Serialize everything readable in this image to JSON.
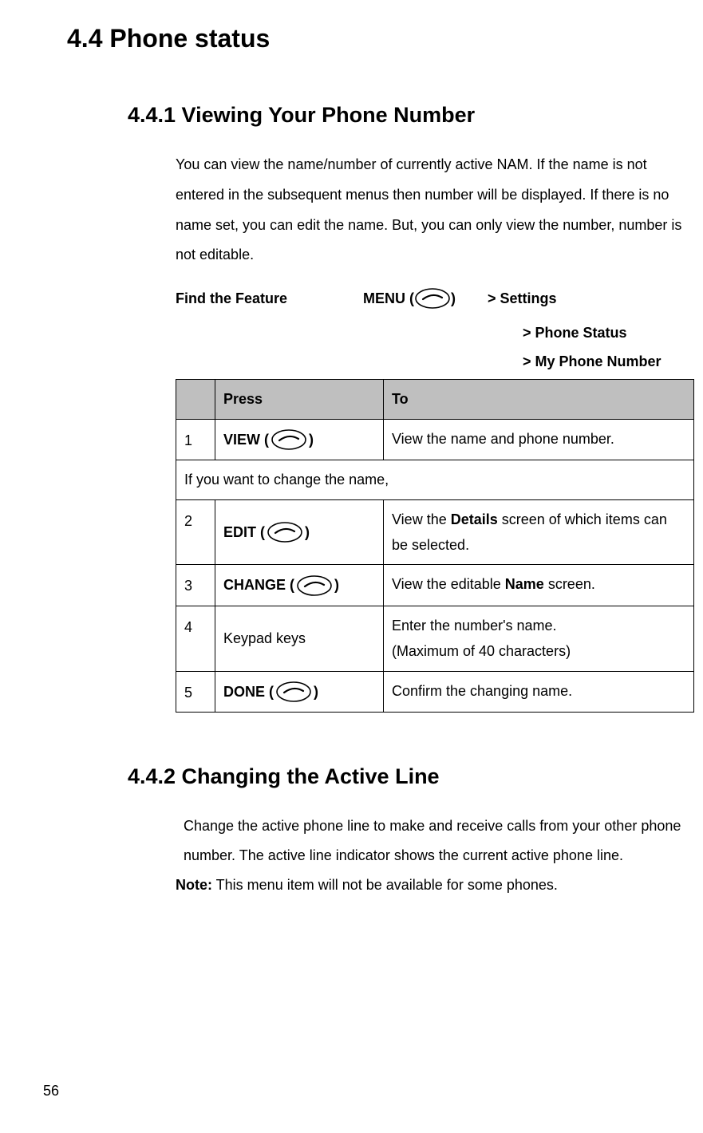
{
  "page_number": "56",
  "h1": "4.4  Phone status",
  "section1": {
    "heading": "4.4.1    Viewing Your Phone Number",
    "para": "You can view the name/number of currently active NAM. If the name is not entered in the subsequent menus then number will be displayed. If there is no name set, you can edit the name. But, you can only view the number, number is not editable.",
    "find_label": "Find the Feature",
    "menu_prefix": "MENU (",
    "menu_suffix": ")",
    "crumb1": "> Settings",
    "crumb2": "> Phone Status",
    "crumb3": "> My Phone Number"
  },
  "table": {
    "headers": {
      "press": "Press",
      "to": "To"
    },
    "rows": [
      {
        "num": "1",
        "press_prefix": "VIEW (",
        "press_suffix": ")",
        "has_icon": true,
        "to_html": "View the name and phone number."
      }
    ],
    "span_row": "If you want to change the name,",
    "rows2": [
      {
        "num": "2",
        "press_prefix": "EDIT (",
        "press_suffix": ")",
        "has_icon": true,
        "to_pre": "View the ",
        "to_bold": "Details",
        "to_post": " screen of which items can be selected."
      },
      {
        "num": "3",
        "press_prefix": "CHANGE (",
        "press_suffix": ")",
        "has_icon": true,
        "to_pre": "View the editable ",
        "to_bold": "Name",
        "to_post": " screen."
      },
      {
        "num": "4",
        "press_plain": "Keypad keys",
        "has_icon": false,
        "to_line1": "Enter the number's name.",
        "to_line2": "(Maximum of 40 characters)"
      },
      {
        "num": "5",
        "press_prefix": "DONE (",
        "press_suffix": ")",
        "has_icon": true,
        "to_html": "Confirm the changing name."
      }
    ]
  },
  "section2": {
    "heading": "4.4.2    Changing the Active Line",
    "para": "Change the active phone line to make and receive calls from your other phone number. The active line indicator shows the current active phone line.",
    "note_bold": "Note:",
    "note_rest": " This menu item will not be available for some phones."
  }
}
